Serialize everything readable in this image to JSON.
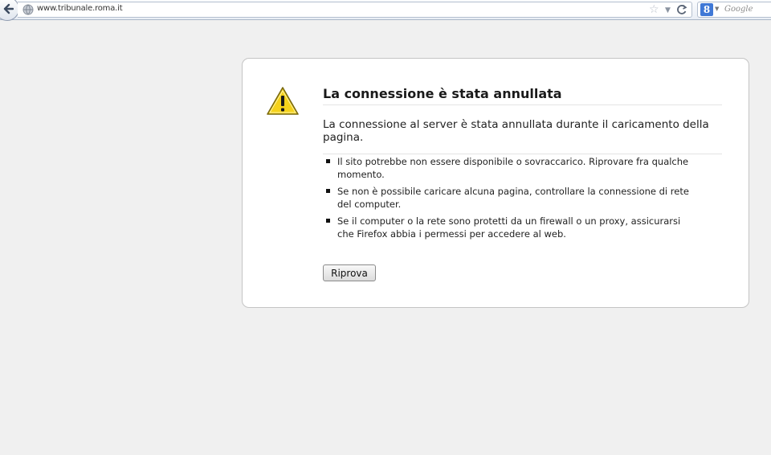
{
  "toolbar": {
    "url": "www.tribunale.roma.it",
    "search_placeholder": "Google",
    "search_engine_letter": "8"
  },
  "error": {
    "title": "La connessione è stata annullata",
    "description": "La connessione al server è stata annullata durante il caricamento della pagina.",
    "suggestions": [
      "Il sito potrebbe non essere disponibile o sovraccarico. Riprovare fra qualche momento.",
      "Se non è possibile caricare alcuna pagina, controllare la connessione di rete del computer.",
      "Se il computer o la rete sono protetti da un firewall o un proxy, assicurarsi che Firefox abbia i permessi per accedere al web."
    ],
    "retry_label": "Riprova"
  },
  "icons": {
    "back": "back-arrow-icon",
    "site": "globe-icon",
    "bookmark": "star-icon",
    "history": "dropdown-arrow-icon",
    "reload": "reload-icon",
    "search_engine": "google-icon",
    "warning": "warning-icon"
  },
  "colors": {
    "page_background": "#f0f0f0",
    "warning_yellow": "#f5d21b",
    "search_engine_blue": "#3f78d6"
  }
}
